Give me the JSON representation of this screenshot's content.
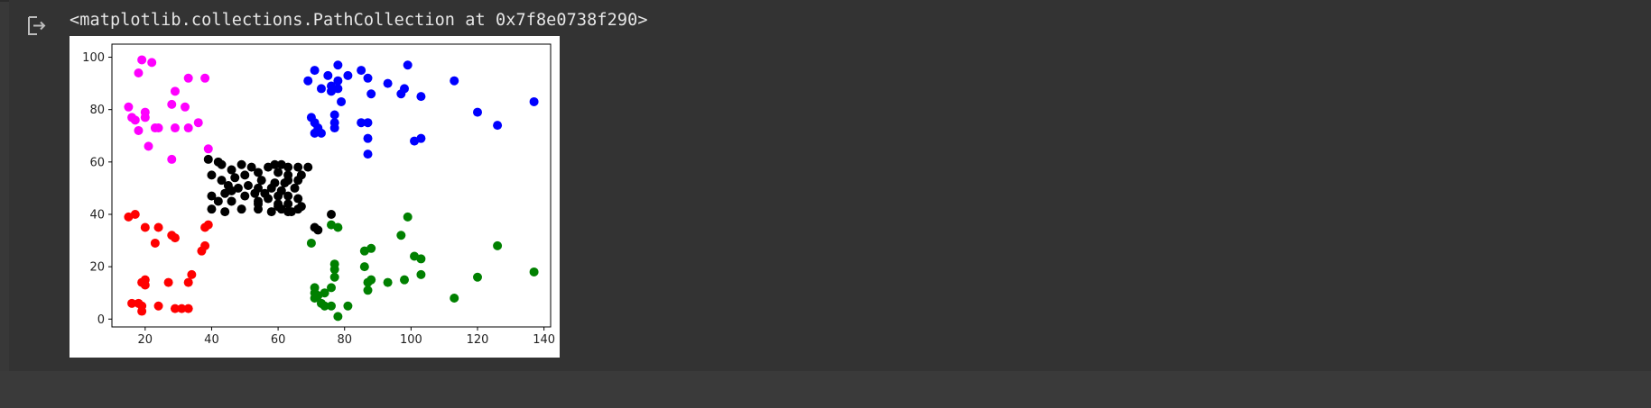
{
  "output": {
    "repr_text": "<matplotlib.collections.PathCollection at 0x7f8e0738f290>"
  },
  "icons": {
    "output_icon": "output-arrow-icon"
  },
  "chart_data": {
    "type": "scatter",
    "title": "",
    "xlabel": "",
    "ylabel": "",
    "xlim": [
      10,
      142
    ],
    "ylim": [
      -3,
      105
    ],
    "xticks": [
      "20",
      "40",
      "60",
      "80",
      "100",
      "120",
      "140"
    ],
    "yticks": [
      "0",
      "20",
      "40",
      "60",
      "80",
      "100"
    ],
    "grid": false,
    "series": [
      {
        "color": "#ff00ff",
        "points": [
          [
            19,
            99
          ],
          [
            22,
            98
          ],
          [
            18,
            94
          ],
          [
            33,
            92
          ],
          [
            38,
            92
          ],
          [
            29,
            87
          ],
          [
            15,
            81
          ],
          [
            20,
            79
          ],
          [
            16,
            77
          ],
          [
            17,
            76
          ],
          [
            20,
            77
          ],
          [
            32,
            81
          ],
          [
            28,
            82
          ],
          [
            18,
            72
          ],
          [
            23,
            73
          ],
          [
            24,
            73
          ],
          [
            29,
            73
          ],
          [
            33,
            73
          ],
          [
            36,
            75
          ],
          [
            21,
            66
          ],
          [
            39,
            65
          ],
          [
            28,
            61
          ]
        ]
      },
      {
        "color": "#0000ff",
        "points": [
          [
            78,
            97
          ],
          [
            99,
            97
          ],
          [
            71,
            95
          ],
          [
            85,
            95
          ],
          [
            75,
            93
          ],
          [
            81,
            93
          ],
          [
            69,
            91
          ],
          [
            78,
            91
          ],
          [
            87,
            92
          ],
          [
            93,
            90
          ],
          [
            76,
            89
          ],
          [
            73,
            88
          ],
          [
            78,
            88
          ],
          [
            98,
            88
          ],
          [
            97,
            86
          ],
          [
            88,
            86
          ],
          [
            103,
            85
          ],
          [
            76,
            87
          ],
          [
            137,
            83
          ],
          [
            79,
            83
          ],
          [
            113,
            91
          ],
          [
            120,
            79
          ],
          [
            70,
            77
          ],
          [
            71,
            75
          ],
          [
            77,
            78
          ],
          [
            77,
            75
          ],
          [
            72,
            73
          ],
          [
            85,
            75
          ],
          [
            87,
            75
          ],
          [
            77,
            73
          ],
          [
            73,
            71
          ],
          [
            71,
            71
          ],
          [
            126,
            74
          ],
          [
            87,
            69
          ],
          [
            101,
            68
          ],
          [
            103,
            69
          ],
          [
            87,
            63
          ]
        ]
      },
      {
        "color": "#000000",
        "points": [
          [
            39,
            61
          ],
          [
            42,
            60
          ],
          [
            43,
            59
          ],
          [
            49,
            59
          ],
          [
            59,
            59
          ],
          [
            52,
            58
          ],
          [
            57,
            58
          ],
          [
            61,
            59
          ],
          [
            63,
            58
          ],
          [
            60,
            56
          ],
          [
            66,
            58
          ],
          [
            69,
            58
          ],
          [
            40,
            55
          ],
          [
            46,
            57
          ],
          [
            50,
            55
          ],
          [
            54,
            56
          ],
          [
            63,
            55
          ],
          [
            67,
            55
          ],
          [
            43,
            53
          ],
          [
            47,
            54
          ],
          [
            55,
            53
          ],
          [
            59,
            52
          ],
          [
            62,
            52
          ],
          [
            66,
            53
          ],
          [
            45,
            51
          ],
          [
            48,
            50
          ],
          [
            51,
            51
          ],
          [
            54,
            50
          ],
          [
            58,
            50
          ],
          [
            61,
            49
          ],
          [
            65,
            50
          ],
          [
            40,
            47
          ],
          [
            44,
            48
          ],
          [
            46,
            49
          ],
          [
            50,
            47
          ],
          [
            53,
            48
          ],
          [
            57,
            46
          ],
          [
            60,
            47
          ],
          [
            63,
            47
          ],
          [
            66,
            46
          ],
          [
            42,
            45
          ],
          [
            46,
            45
          ],
          [
            54,
            44
          ],
          [
            60,
            43
          ],
          [
            63,
            44
          ],
          [
            67,
            43
          ],
          [
            44,
            41
          ],
          [
            49,
            42
          ],
          [
            54,
            42
          ],
          [
            58,
            41
          ],
          [
            61,
            42
          ],
          [
            64,
            41
          ],
          [
            66,
            42
          ],
          [
            40,
            42
          ],
          [
            54,
            45
          ],
          [
            63,
            41
          ],
          [
            76,
            40
          ],
          [
            71,
            35
          ],
          [
            72,
            34
          ],
          [
            60,
            44
          ],
          [
            56,
            48
          ],
          [
            63,
            53
          ]
        ]
      },
      {
        "color": "#ff0000",
        "points": [
          [
            15,
            39
          ],
          [
            17,
            40
          ],
          [
            20,
            35
          ],
          [
            24,
            35
          ],
          [
            28,
            32
          ],
          [
            29,
            31
          ],
          [
            23,
            29
          ],
          [
            38,
            35
          ],
          [
            39,
            36
          ],
          [
            38,
            28
          ],
          [
            37,
            26
          ],
          [
            19,
            14
          ],
          [
            20,
            15
          ],
          [
            20,
            13
          ],
          [
            27,
            14
          ],
          [
            33,
            14
          ],
          [
            34,
            17
          ],
          [
            16,
            6
          ],
          [
            18,
            6
          ],
          [
            19,
            5
          ],
          [
            24,
            5
          ],
          [
            29,
            4
          ],
          [
            31,
            4
          ],
          [
            33,
            4
          ],
          [
            19,
            3
          ]
        ]
      },
      {
        "color": "#008000",
        "points": [
          [
            99,
            39
          ],
          [
            76,
            36
          ],
          [
            78,
            35
          ],
          [
            97,
            32
          ],
          [
            70,
            29
          ],
          [
            88,
            27
          ],
          [
            86,
            26
          ],
          [
            126,
            28
          ],
          [
            101,
            24
          ],
          [
            103,
            23
          ],
          [
            77,
            21
          ],
          [
            77,
            19
          ],
          [
            86,
            20
          ],
          [
            137,
            18
          ],
          [
            103,
            17
          ],
          [
            120,
            16
          ],
          [
            77,
            16
          ],
          [
            88,
            15
          ],
          [
            87,
            14
          ],
          [
            98,
            15
          ],
          [
            93,
            14
          ],
          [
            71,
            12
          ],
          [
            76,
            12
          ],
          [
            71,
            10
          ],
          [
            74,
            10
          ],
          [
            87,
            11
          ],
          [
            71,
            8
          ],
          [
            73,
            6
          ],
          [
            74,
            5
          ],
          [
            76,
            5
          ],
          [
            81,
            5
          ],
          [
            113,
            8
          ],
          [
            78,
            1
          ],
          [
            72,
            9
          ]
        ]
      }
    ]
  }
}
